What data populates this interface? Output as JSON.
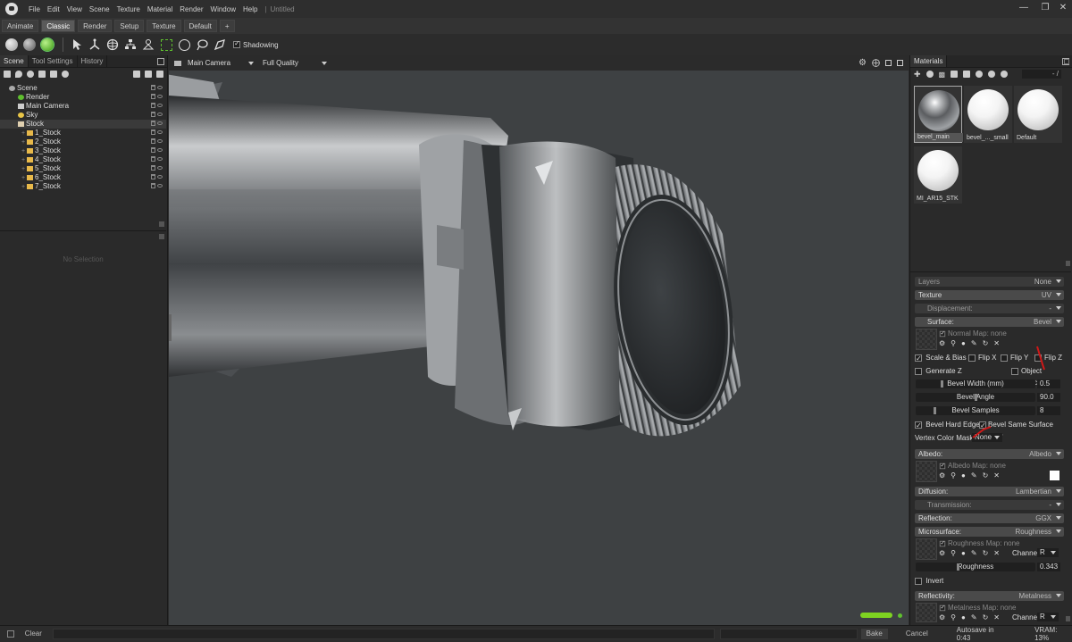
{
  "window": {
    "title": "Untitled",
    "menu": [
      "File",
      "Edit",
      "View",
      "Scene",
      "Texture",
      "Material",
      "Render",
      "Window",
      "Help"
    ]
  },
  "modes": {
    "tabs": [
      "Animate",
      "Classic",
      "Render",
      "Setup",
      "Texture",
      "Default",
      "+"
    ],
    "active": "Classic"
  },
  "toolbar": {
    "shadowing_label": "Shadowing"
  },
  "scene_panel": {
    "tabs": [
      "Scene",
      "Tool Settings",
      "History"
    ],
    "tree": [
      {
        "label": "Scene",
        "indent": 0,
        "icon": "scene-icon"
      },
      {
        "label": "Render",
        "indent": 1,
        "icon": "render-icon"
      },
      {
        "label": "Main Camera",
        "indent": 1,
        "icon": "camera-icon"
      },
      {
        "label": "Sky",
        "indent": 1,
        "icon": "sky-icon"
      },
      {
        "label": "Stock",
        "indent": 1,
        "icon": "mesh-icon"
      },
      {
        "label": "1_Stock",
        "indent": 2,
        "icon": "folder-icon"
      },
      {
        "label": "2_Stock",
        "indent": 2,
        "icon": "folder-icon"
      },
      {
        "label": "3_Stock",
        "indent": 2,
        "icon": "folder-icon"
      },
      {
        "label": "4_Stock",
        "indent": 2,
        "icon": "folder-icon"
      },
      {
        "label": "5_Stock",
        "indent": 2,
        "icon": "folder-icon"
      },
      {
        "label": "6_Stock",
        "indent": 2,
        "icon": "folder-icon"
      },
      {
        "label": "7_Stock",
        "indent": 2,
        "icon": "folder-icon"
      }
    ],
    "empty_text": "No Selection"
  },
  "viewport": {
    "camera": "Main Camera",
    "quality": "Full Quality"
  },
  "materials": {
    "tab": "Materials",
    "search_value": "- /",
    "items": [
      "bevel_main",
      "bevel_..._small",
      "Default",
      "MI_AR15_STK"
    ]
  },
  "props": {
    "layers": {
      "label": "Layers",
      "value": "None"
    },
    "texture": {
      "label": "Texture",
      "value": "UV"
    },
    "displacement": {
      "label": "Displacement:",
      "value": "-"
    },
    "surface": {
      "label": "Surface:",
      "value": "Bevel"
    },
    "normal_map": "Normal Map: none",
    "scale_bias": "Scale & Bias",
    "flip_x": "Flip X",
    "flip_y": "Flip Y",
    "flip_z": "Flip Z",
    "generate_z": "Generate Z",
    "object_space": "Object Space",
    "bevel_width": {
      "label": "Bevel Width (mm)",
      "value": "0.5"
    },
    "bevel_angle": {
      "label": "Bevel Angle",
      "value": "90.0"
    },
    "bevel_samples": {
      "label": "Bevel Samples",
      "value": "8"
    },
    "bevel_hard_edges": "Bevel Hard Edges",
    "bevel_same_surface": "Bevel Same Surface Only",
    "vertex_color_mask": {
      "label": "Vertex Color Mask",
      "value": "None"
    },
    "albedo": {
      "label": "Albedo:",
      "value": "Albedo"
    },
    "albedo_map": "Albedo Map: none",
    "diffusion": {
      "label": "Diffusion:",
      "value": "Lambertian"
    },
    "transmission": {
      "label": "Transmission:",
      "value": "-"
    },
    "reflection": {
      "label": "Reflection:",
      "value": "GGX"
    },
    "microsurface": {
      "label": "Microsurface:",
      "value": "Roughness"
    },
    "roughness_map": "Roughness Map: none",
    "channel_label": "Channel",
    "channel_value": "R",
    "roughness": {
      "label": "Roughness",
      "value": "0.343"
    },
    "invert": "Invert",
    "reflectivity": {
      "label": "Reflectivity:",
      "value": "Metalness"
    },
    "metalness_map": "Metalness Map: none",
    "channel_value_2": "R"
  },
  "status": {
    "clear": "Clear",
    "bake": "Bake",
    "cancel": "Cancel",
    "autosave": "Autosave in 0:43",
    "vram": "VRAM: 13%"
  },
  "colors": {
    "accent": "#5fbf2f",
    "annotation": "#d01818"
  }
}
